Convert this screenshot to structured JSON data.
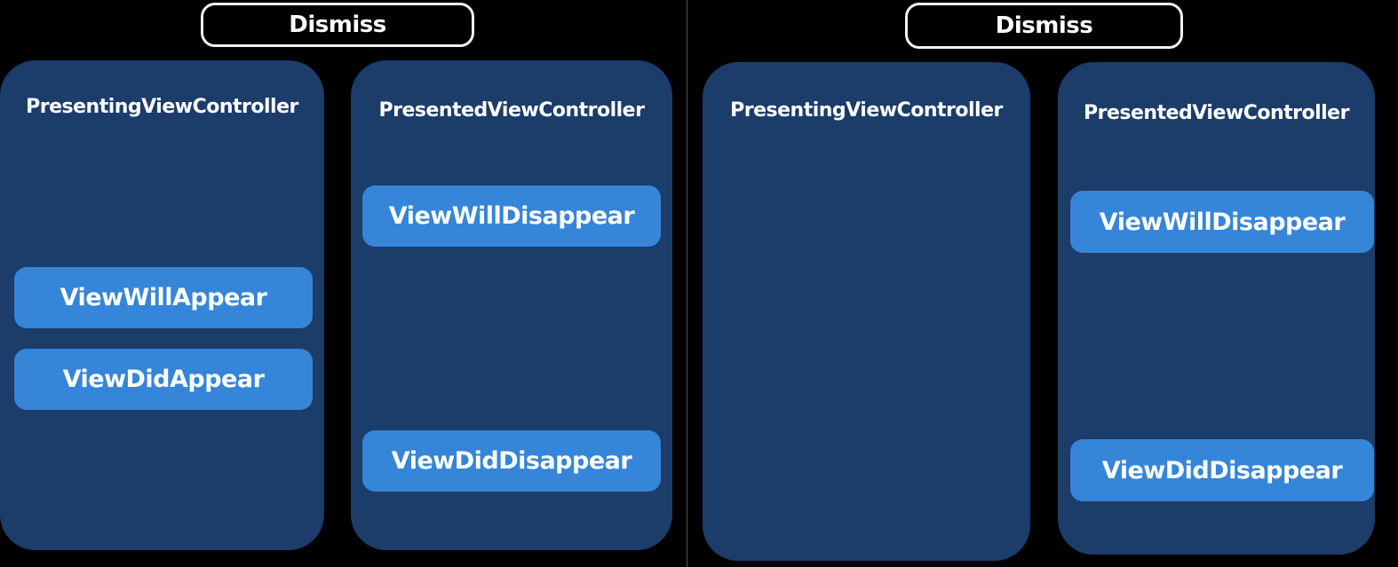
{
  "left": {
    "dismiss_label": "Dismiss",
    "presenting": {
      "title": "PresentingViewController",
      "events": [
        "ViewWillAppear",
        "ViewDidAppear"
      ]
    },
    "presented": {
      "title": "PresentedViewController",
      "events": [
        "ViewWillDisappear",
        "ViewDidDisappear"
      ]
    }
  },
  "right": {
    "dismiss_label": "Dismiss",
    "presenting": {
      "title": "PresentingViewController",
      "events": []
    },
    "presented": {
      "title": "PresentedViewController",
      "events": [
        "ViewWillDisappear",
        "ViewDidDisappear"
      ]
    }
  },
  "colors": {
    "background": "#000000",
    "panel": "#1c3c6a",
    "event_box": "#3585d8",
    "text": "#ffffff"
  }
}
